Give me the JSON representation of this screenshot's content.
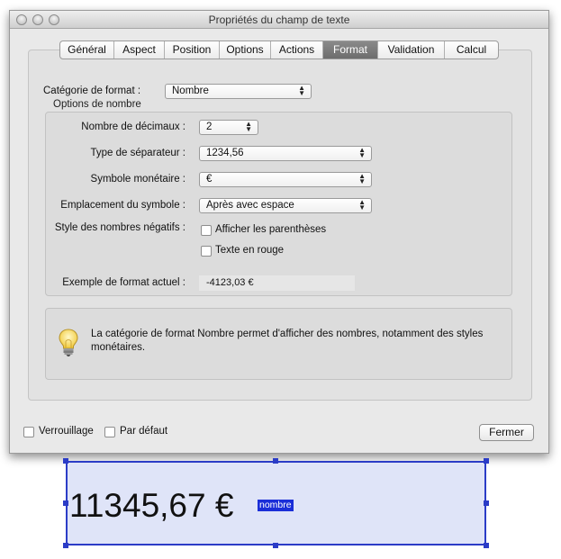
{
  "window": {
    "title": "Propriétés du champ de texte"
  },
  "tabs": [
    {
      "label": "Général"
    },
    {
      "label": "Aspect"
    },
    {
      "label": "Position"
    },
    {
      "label": "Options"
    },
    {
      "label": "Actions"
    },
    {
      "label": "Format",
      "selected": true
    },
    {
      "label": "Validation"
    },
    {
      "label": "Calcul"
    }
  ],
  "format": {
    "category_label": "Catégorie de format :",
    "category_value": "Nombre",
    "group_title": "Options de nombre",
    "decimals_label": "Nombre de décimaux :",
    "decimals_value": "2",
    "separator_label": "Type de séparateur :",
    "separator_value": "1234,56",
    "currency_label": "Symbole monétaire :",
    "currency_value": "€",
    "placement_label": "Emplacement du symbole :",
    "placement_value": "Après avec espace",
    "negative_label": "Style des nombres négatifs :",
    "parentheses_label": "Afficher les parenthèses",
    "parentheses_checked": false,
    "red_label": "Texte en rouge",
    "red_checked": false,
    "sample_label": "Exemple de format actuel :",
    "sample_value": "-4123,03 €",
    "info_text": "La catégorie de format Nombre permet d'afficher des nombres, notamment des styles monétaires."
  },
  "footer": {
    "lock_label": "Verrouillage",
    "lock_checked": false,
    "default_label": "Par défaut",
    "default_checked": false,
    "close_label": "Fermer"
  },
  "field_preview": {
    "value": "11345,67 €",
    "tag": "nombre"
  },
  "colors": {
    "selected_tab": "#767676",
    "field_border": "#2b3cc7",
    "field_fill": "#dfe4f8",
    "tag_background": "#1a2ed8"
  },
  "icons": [
    "close-window-icon",
    "minimize-window-icon",
    "zoom-window-icon",
    "lightbulb-icon",
    "popup-arrows-icon",
    "resize-handle-icon"
  ]
}
